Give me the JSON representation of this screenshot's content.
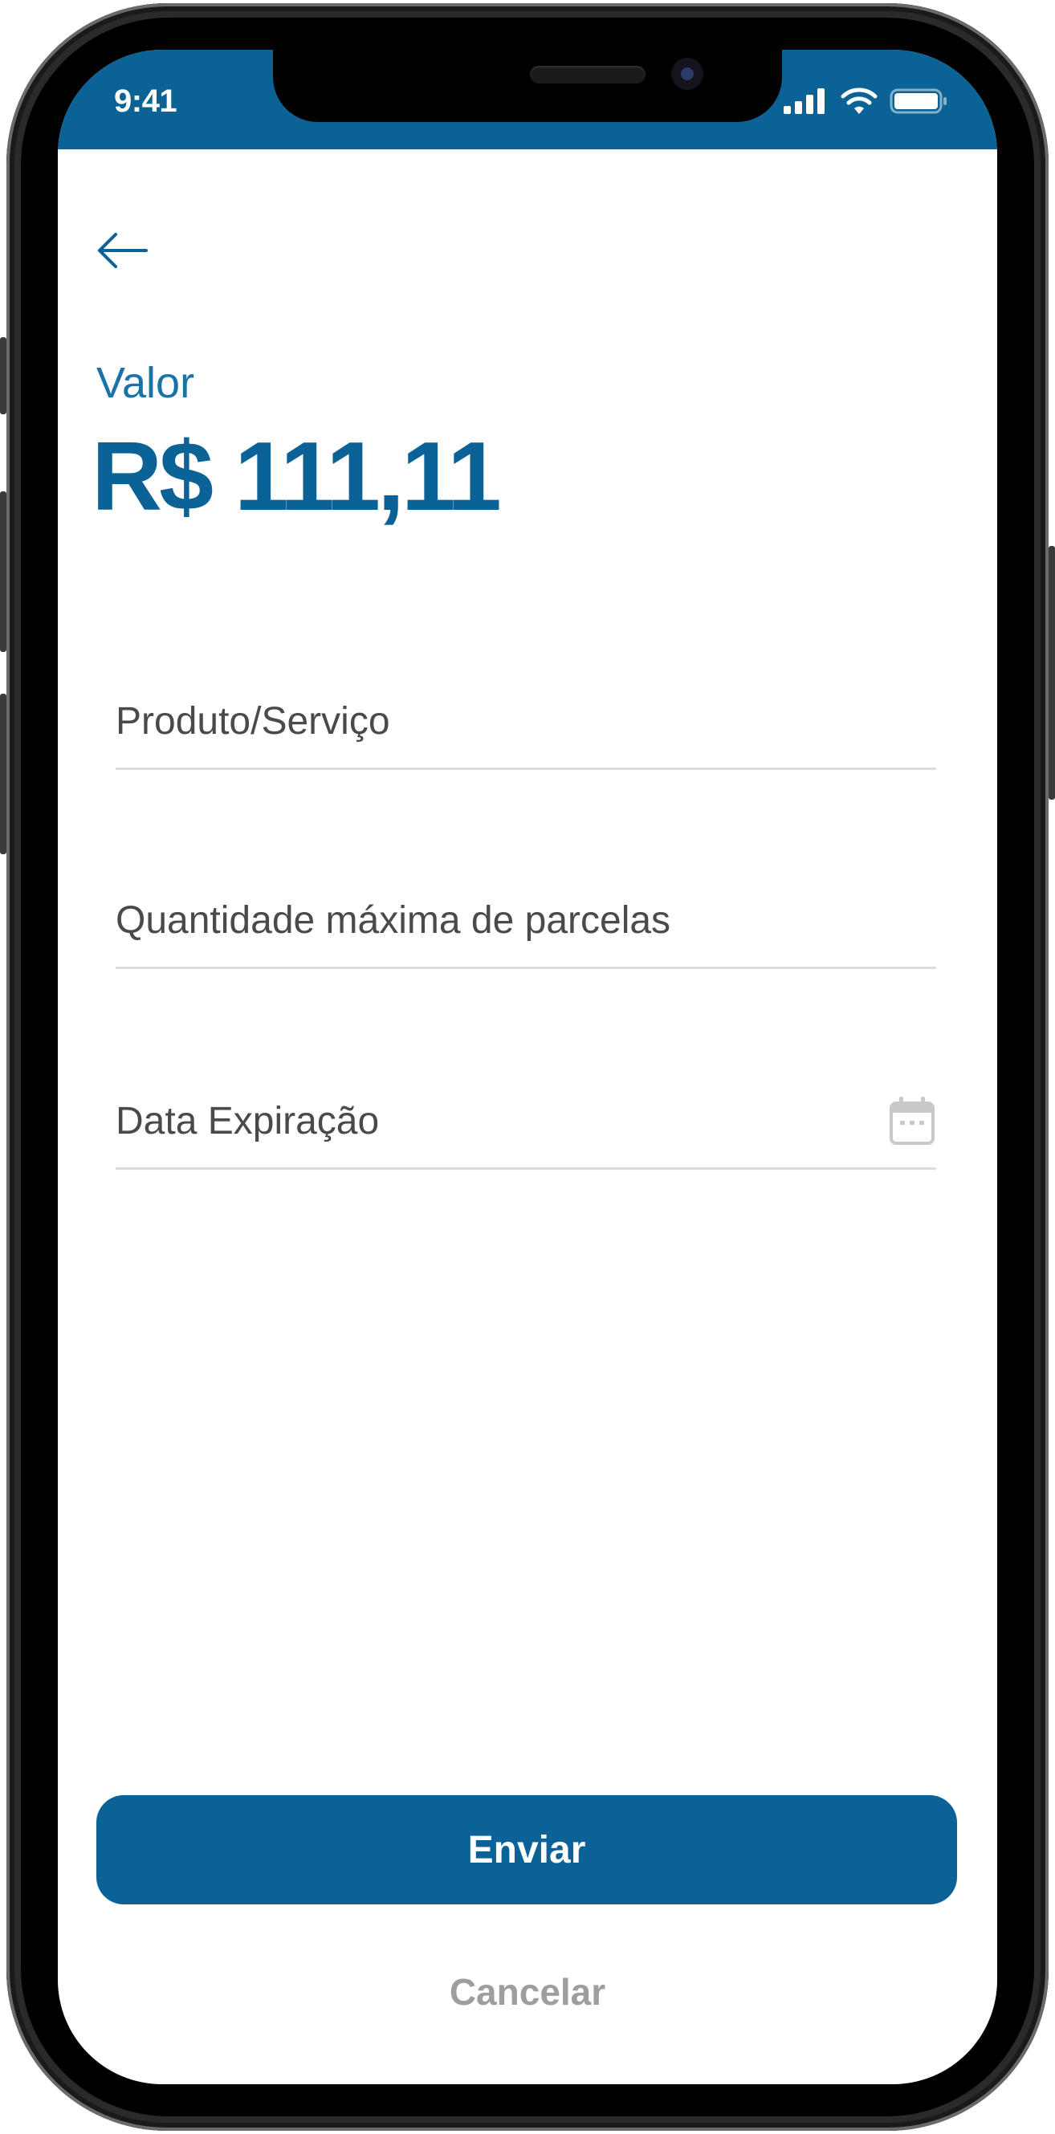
{
  "status_bar": {
    "time": "9:41",
    "signal_icon": "cellular-signal-icon",
    "wifi_icon": "wifi-icon",
    "battery_icon": "battery-icon",
    "background_color": "#0b6296"
  },
  "header": {
    "back_icon": "arrow-left-icon"
  },
  "amount": {
    "label": "Valor",
    "value": "R$ 111,11"
  },
  "form": {
    "product_label": "Produto/Serviço",
    "installments_label": "Quantidade máxima de parcelas",
    "expiration_label": "Data Expiração",
    "expiration_icon": "calendar-icon"
  },
  "actions": {
    "submit_label": "Enviar",
    "cancel_label": "Cancelar"
  },
  "colors": {
    "primary": "#0b6296",
    "label_blue": "#1a73a8",
    "muted": "#9e9e9e",
    "field_text": "#4a4a4a",
    "divider": "#dcdcdc"
  }
}
